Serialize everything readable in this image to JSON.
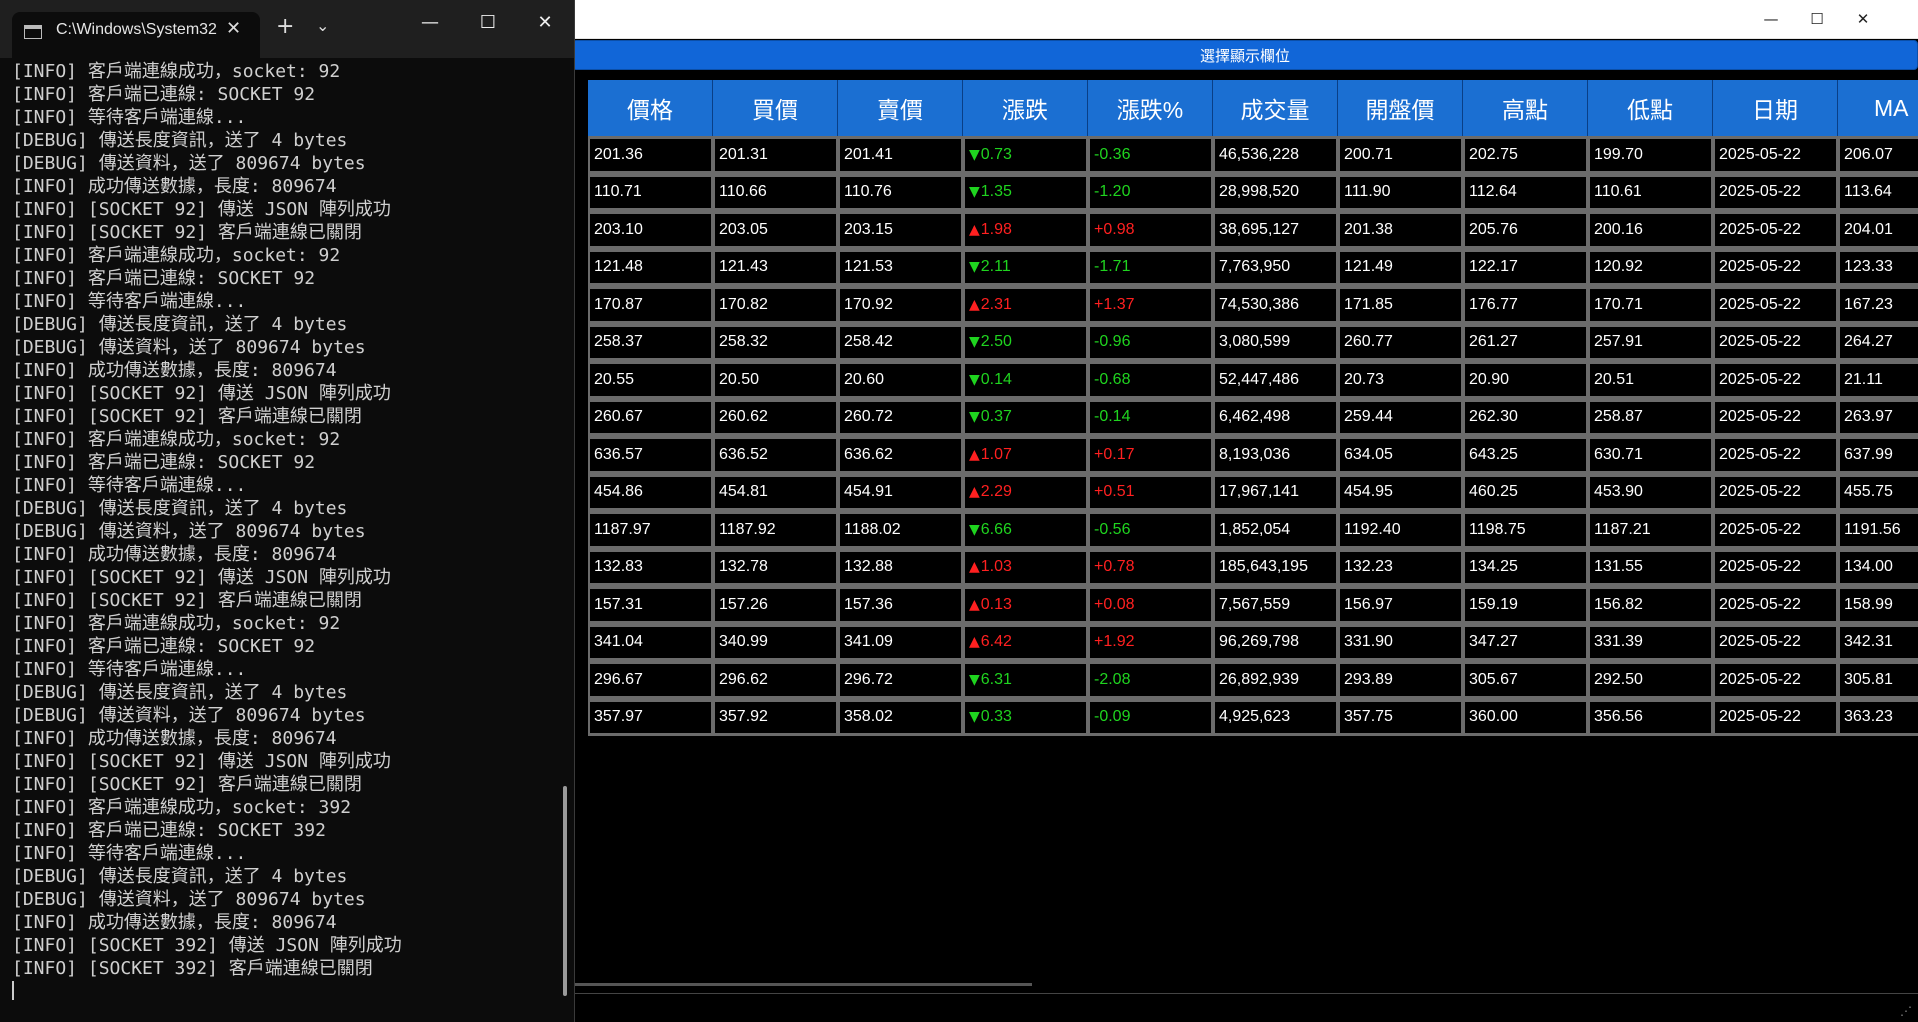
{
  "stock_window": {
    "title_controls": {
      "minimize": "—",
      "maximize": "☐",
      "close": "✕"
    },
    "column_select_button": "選擇顯示欄位",
    "table": {
      "columns": [
        "價格",
        "買價",
        "賣價",
        "漲跌",
        "漲跌%",
        "成交量",
        "開盤價",
        "高點",
        "低點",
        "日期",
        "MA"
      ],
      "rows": [
        {
          "price": "201.36",
          "bid": "201.31",
          "ask": "201.41",
          "dir": "down",
          "change": "0.73",
          "pct": "-0.36",
          "volume": "46,536,228",
          "open": "200.71",
          "high": "202.75",
          "low": "199.70",
          "date": "2025-05-22",
          "ma": "206.07"
        },
        {
          "price": "110.71",
          "bid": "110.66",
          "ask": "110.76",
          "dir": "down",
          "change": "1.35",
          "pct": "-1.20",
          "volume": "28,998,520",
          "open": "111.90",
          "high": "112.64",
          "low": "110.61",
          "date": "2025-05-22",
          "ma": "113.64"
        },
        {
          "price": "203.10",
          "bid": "203.05",
          "ask": "203.15",
          "dir": "up",
          "change": "1.98",
          "pct": "+0.98",
          "volume": "38,695,127",
          "open": "201.38",
          "high": "205.76",
          "low": "200.16",
          "date": "2025-05-22",
          "ma": "204.01"
        },
        {
          "price": "121.48",
          "bid": "121.43",
          "ask": "121.53",
          "dir": "down",
          "change": "2.11",
          "pct": "-1.71",
          "volume": "7,763,950",
          "open": "121.49",
          "high": "122.17",
          "low": "120.92",
          "date": "2025-05-22",
          "ma": "123.33"
        },
        {
          "price": "170.87",
          "bid": "170.82",
          "ask": "170.92",
          "dir": "up",
          "change": "2.31",
          "pct": "+1.37",
          "volume": "74,530,386",
          "open": "171.85",
          "high": "176.77",
          "low": "170.71",
          "date": "2025-05-22",
          "ma": "167.23"
        },
        {
          "price": "258.37",
          "bid": "258.32",
          "ask": "258.42",
          "dir": "down",
          "change": "2.50",
          "pct": "-0.96",
          "volume": "3,080,599",
          "open": "260.77",
          "high": "261.27",
          "low": "257.91",
          "date": "2025-05-22",
          "ma": "264.27"
        },
        {
          "price": "20.55",
          "bid": "20.50",
          "ask": "20.60",
          "dir": "down",
          "change": "0.14",
          "pct": "-0.68",
          "volume": "52,447,486",
          "open": "20.73",
          "high": "20.90",
          "low": "20.51",
          "date": "2025-05-22",
          "ma": "21.11"
        },
        {
          "price": "260.67",
          "bid": "260.62",
          "ask": "260.72",
          "dir": "down",
          "change": "0.37",
          "pct": "-0.14",
          "volume": "6,462,498",
          "open": "259.44",
          "high": "262.30",
          "low": "258.87",
          "date": "2025-05-22",
          "ma": "263.97"
        },
        {
          "price": "636.57",
          "bid": "636.52",
          "ask": "636.62",
          "dir": "up",
          "change": "1.07",
          "pct": "+0.17",
          "volume": "8,193,036",
          "open": "634.05",
          "high": "643.25",
          "low": "630.71",
          "date": "2025-05-22",
          "ma": "637.99"
        },
        {
          "price": "454.86",
          "bid": "454.81",
          "ask": "454.91",
          "dir": "up",
          "change": "2.29",
          "pct": "+0.51",
          "volume": "17,967,141",
          "open": "454.95",
          "high": "460.25",
          "low": "453.90",
          "date": "2025-05-22",
          "ma": "455.75"
        },
        {
          "price": "1187.97",
          "bid": "1187.92",
          "ask": "1188.02",
          "dir": "down",
          "change": "6.66",
          "pct": "-0.56",
          "volume": "1,852,054",
          "open": "1192.40",
          "high": "1198.75",
          "low": "1187.21",
          "date": "2025-05-22",
          "ma": "1191.56"
        },
        {
          "price": "132.83",
          "bid": "132.78",
          "ask": "132.88",
          "dir": "up",
          "change": "1.03",
          "pct": "+0.78",
          "volume": "185,643,195",
          "open": "132.23",
          "high": "134.25",
          "low": "131.55",
          "date": "2025-05-22",
          "ma": "134.00"
        },
        {
          "price": "157.31",
          "bid": "157.26",
          "ask": "157.36",
          "dir": "up",
          "change": "0.13",
          "pct": "+0.08",
          "volume": "7,567,559",
          "open": "156.97",
          "high": "159.19",
          "low": "156.82",
          "date": "2025-05-22",
          "ma": "158.99"
        },
        {
          "price": "341.04",
          "bid": "340.99",
          "ask": "341.09",
          "dir": "up",
          "change": "6.42",
          "pct": "+1.92",
          "volume": "96,269,798",
          "open": "331.90",
          "high": "347.27",
          "low": "331.39",
          "date": "2025-05-22",
          "ma": "342.31"
        },
        {
          "price": "296.67",
          "bid": "296.62",
          "ask": "296.72",
          "dir": "down",
          "change": "6.31",
          "pct": "-2.08",
          "volume": "26,892,939",
          "open": "293.89",
          "high": "305.67",
          "low": "292.50",
          "date": "2025-05-22",
          "ma": "305.81"
        },
        {
          "price": "357.97",
          "bid": "357.92",
          "ask": "358.02",
          "dir": "down",
          "change": "0.33",
          "pct": "-0.09",
          "volume": "4,925,623",
          "open": "357.75",
          "high": "360.00",
          "low": "356.56",
          "date": "2025-05-22",
          "ma": "363.23"
        }
      ]
    },
    "colors": {
      "up": "#ff2020",
      "down": "#1fd41f",
      "header_bg": "#1b6fd2",
      "button_bg": "#1166d8"
    },
    "arrow_up": "▲",
    "arrow_down": "▼"
  },
  "terminal": {
    "tab_title": "C:\\Windows\\System32",
    "tab_close": "✕",
    "new_tab": "+",
    "dropdown": "⌄",
    "controls": {
      "minimize": "—",
      "maximize": "☐",
      "close": "✕"
    },
    "log_lines": [
      "[INFO] 客戶端連線成功，socket: 92",
      "[INFO] 客戶端已連線: SOCKET 92",
      "[INFO] 等待客戶端連線...",
      "[DEBUG] 傳送長度資訊，送了 4 bytes",
      "[DEBUG] 傳送資料，送了 809674 bytes",
      "[INFO] 成功傳送數據，長度: 809674",
      "[INFO] [SOCKET 92] 傳送 JSON 陣列成功",
      "[INFO] [SOCKET 92] 客戶端連線已關閉",
      "[INFO] 客戶端連線成功，socket: 92",
      "[INFO] 客戶端已連線: SOCKET 92",
      "[INFO] 等待客戶端連線...",
      "[DEBUG] 傳送長度資訊，送了 4 bytes",
      "[DEBUG] 傳送資料，送了 809674 bytes",
      "[INFO] 成功傳送數據，長度: 809674",
      "[INFO] [SOCKET 92] 傳送 JSON 陣列成功",
      "[INFO] [SOCKET 92] 客戶端連線已關閉",
      "[INFO] 客戶端連線成功，socket: 92",
      "[INFO] 客戶端已連線: SOCKET 92",
      "[INFO] 等待客戶端連線...",
      "[DEBUG] 傳送長度資訊，送了 4 bytes",
      "[DEBUG] 傳送資料，送了 809674 bytes",
      "[INFO] 成功傳送數據，長度: 809674",
      "[INFO] [SOCKET 92] 傳送 JSON 陣列成功",
      "[INFO] [SOCKET 92] 客戶端連線已關閉",
      "[INFO] 客戶端連線成功，socket: 92",
      "[INFO] 客戶端已連線: SOCKET 92",
      "[INFO] 等待客戶端連線...",
      "[DEBUG] 傳送長度資訊，送了 4 bytes",
      "[DEBUG] 傳送資料，送了 809674 bytes",
      "[INFO] 成功傳送數據，長度: 809674",
      "[INFO] [SOCKET 92] 傳送 JSON 陣列成功",
      "[INFO] [SOCKET 92] 客戶端連線已關閉",
      "[INFO] 客戶端連線成功，socket: 392",
      "[INFO] 客戶端已連線: SOCKET 392",
      "[INFO] 等待客戶端連線...",
      "[DEBUG] 傳送長度資訊，送了 4 bytes",
      "[DEBUG] 傳送資料，送了 809674 bytes",
      "[INFO] 成功傳送數據，長度: 809674",
      "[INFO] [SOCKET 392] 傳送 JSON 陣列成功",
      "[INFO] [SOCKET 392] 客戶端連線已關閉"
    ]
  }
}
